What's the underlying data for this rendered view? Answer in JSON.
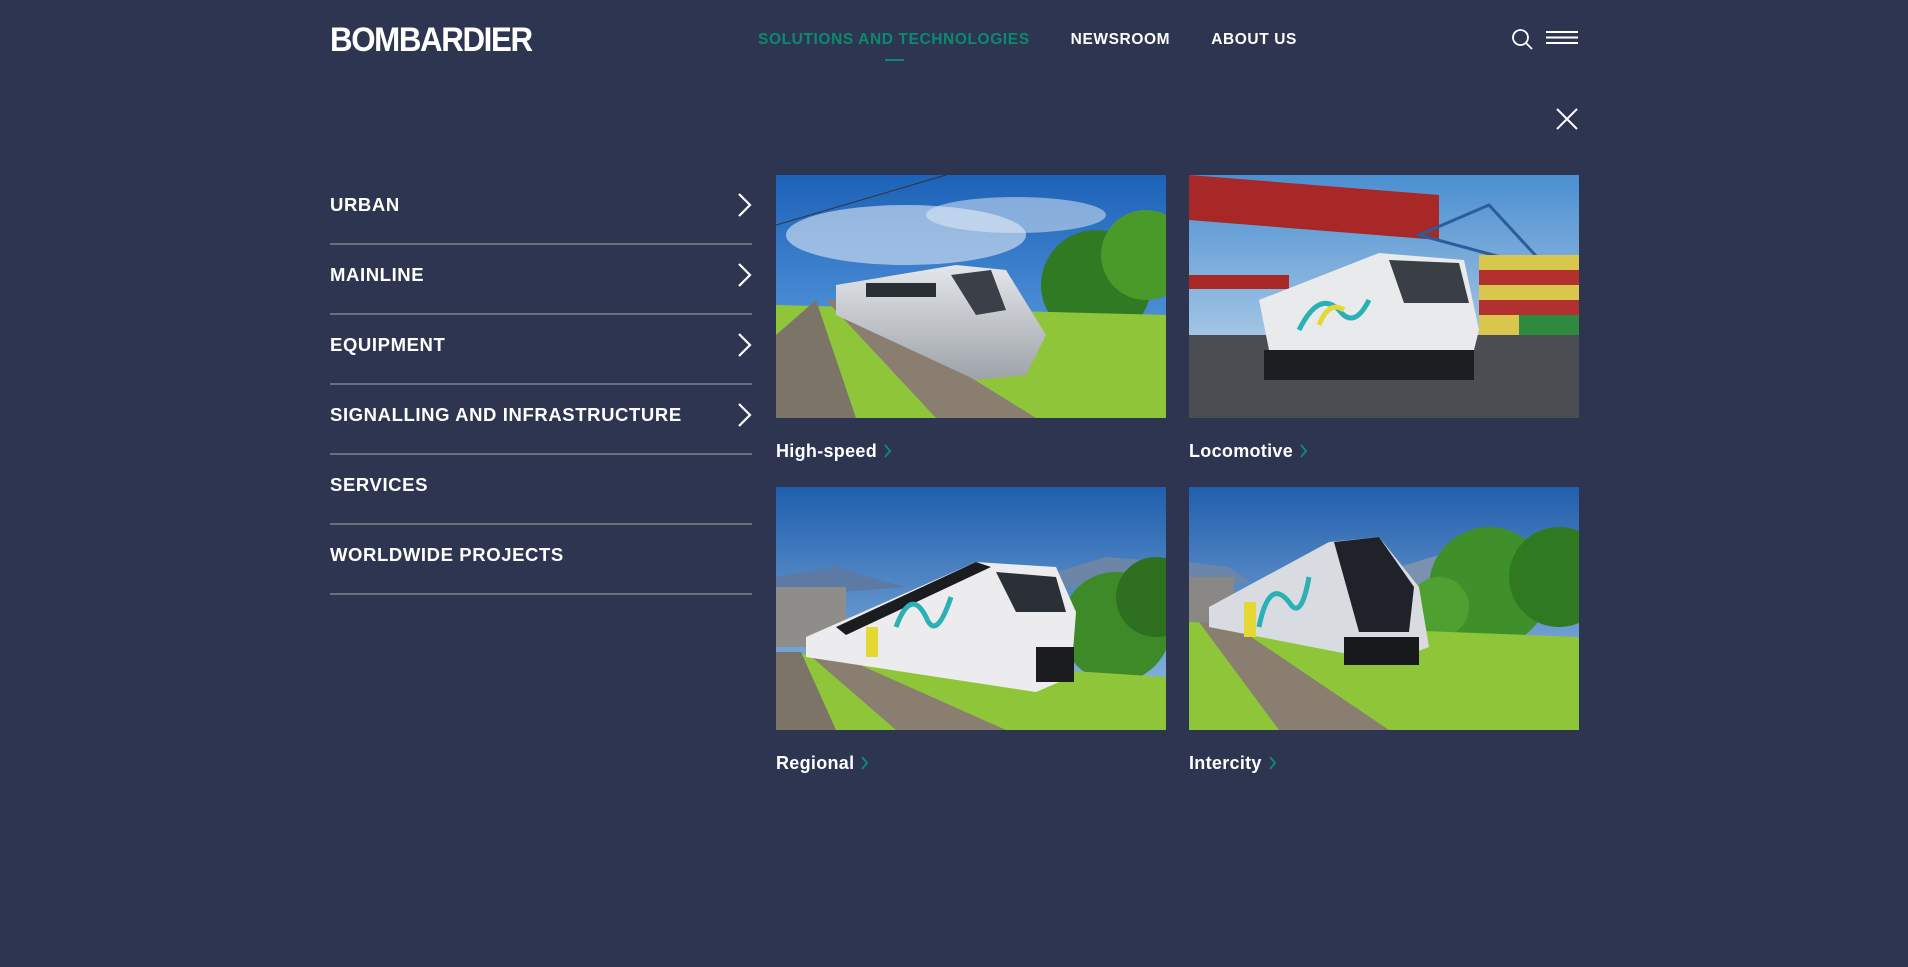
{
  "header": {
    "logo": "BOMBARDIER",
    "nav": [
      {
        "label": "SOLUTIONS AND TECHNOLOGIES",
        "active": true
      },
      {
        "label": "NEWSROOM",
        "active": false
      },
      {
        "label": "ABOUT US",
        "active": false
      }
    ],
    "icons": {
      "search": "search-icon",
      "menu": "hamburger-menu-icon",
      "close": "close-icon"
    }
  },
  "menu": {
    "items": [
      {
        "label": "URBAN",
        "has_submenu": true
      },
      {
        "label": "MAINLINE",
        "has_submenu": true
      },
      {
        "label": "EQUIPMENT",
        "has_submenu": true
      },
      {
        "label": "SIGNALLING AND INFRASTRUCTURE",
        "has_submenu": true
      },
      {
        "label": "SERVICES",
        "has_submenu": false
      },
      {
        "label": "WORLDWIDE PROJECTS",
        "has_submenu": false
      }
    ]
  },
  "cards": [
    {
      "label": "High-speed",
      "image": "high-speed train in green countryside"
    },
    {
      "label": "Locomotive",
      "image": "white locomotive at container port"
    },
    {
      "label": "Regional",
      "image": "double-deck regional train near mountains"
    },
    {
      "label": "Intercity",
      "image": "intercity double-deck train among trees"
    }
  ],
  "colors": {
    "background": "#2d3550",
    "accent": "#0b8a6f",
    "divider": "#6b6e7d",
    "text": "#ffffff"
  }
}
